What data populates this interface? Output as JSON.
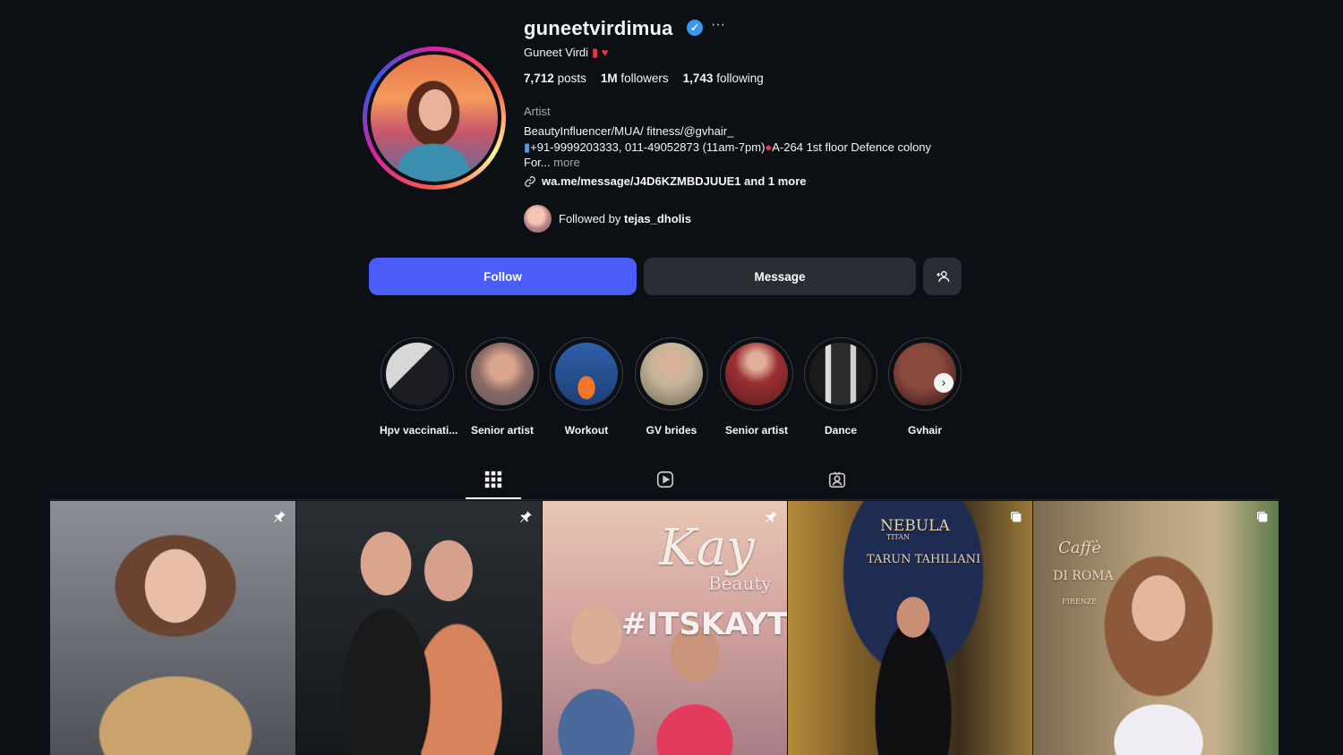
{
  "profile": {
    "username": "guneetvirdimua",
    "full_name": "Guneet Virdi",
    "category": "Artist",
    "stats": [
      {
        "value": "7,712",
        "label": "posts"
      },
      {
        "value": "1M",
        "label": "followers"
      },
      {
        "value": "1,743",
        "label": "following"
      }
    ],
    "bio_line1": "BeautyInfluencer/MUA/ fitness/@gvhair_",
    "bio_line2": "+91-9999203333, 011-49052873 (11am-7pm)",
    "bio_line2_b": "A-264 1st floor Defence colony",
    "bio_line3": "For...",
    "more_label": "more",
    "link": "wa.me/message/J4D6KZMBDJUUE1 and 1 more",
    "followed_by_prefix": "Followed by",
    "followed_by_user": "tejas_dholis"
  },
  "actions": {
    "follow": "Follow",
    "message": "Message"
  },
  "highlights": [
    {
      "label": "Hpv vaccinati..."
    },
    {
      "label": "Senior artist"
    },
    {
      "label": "Workout"
    },
    {
      "label": "GV brides"
    },
    {
      "label": "Senior artist"
    },
    {
      "label": "Dance"
    },
    {
      "label": "Gvhair"
    }
  ],
  "posts": [
    {
      "badge": "pin-icon"
    },
    {
      "badge": "pin-icon"
    },
    {
      "badge": "pin-icon",
      "text1": "Kay",
      "text2": "Beauty",
      "text3": "#ITSKAYTOB"
    },
    {
      "badge": "carousel-icon",
      "text1": "NEBULA",
      "text2": "TITAN",
      "text3": "TARUN TAHILIANI"
    },
    {
      "badge": "carousel-icon",
      "text1": "Caffè",
      "text2": "DI ROMA",
      "text3": "FIRENZE"
    }
  ],
  "colors": {
    "background": "#0c0f14",
    "follow_button": "#4a5df9",
    "secondary_button": "#2a2d33",
    "verified": "#3897f0"
  }
}
